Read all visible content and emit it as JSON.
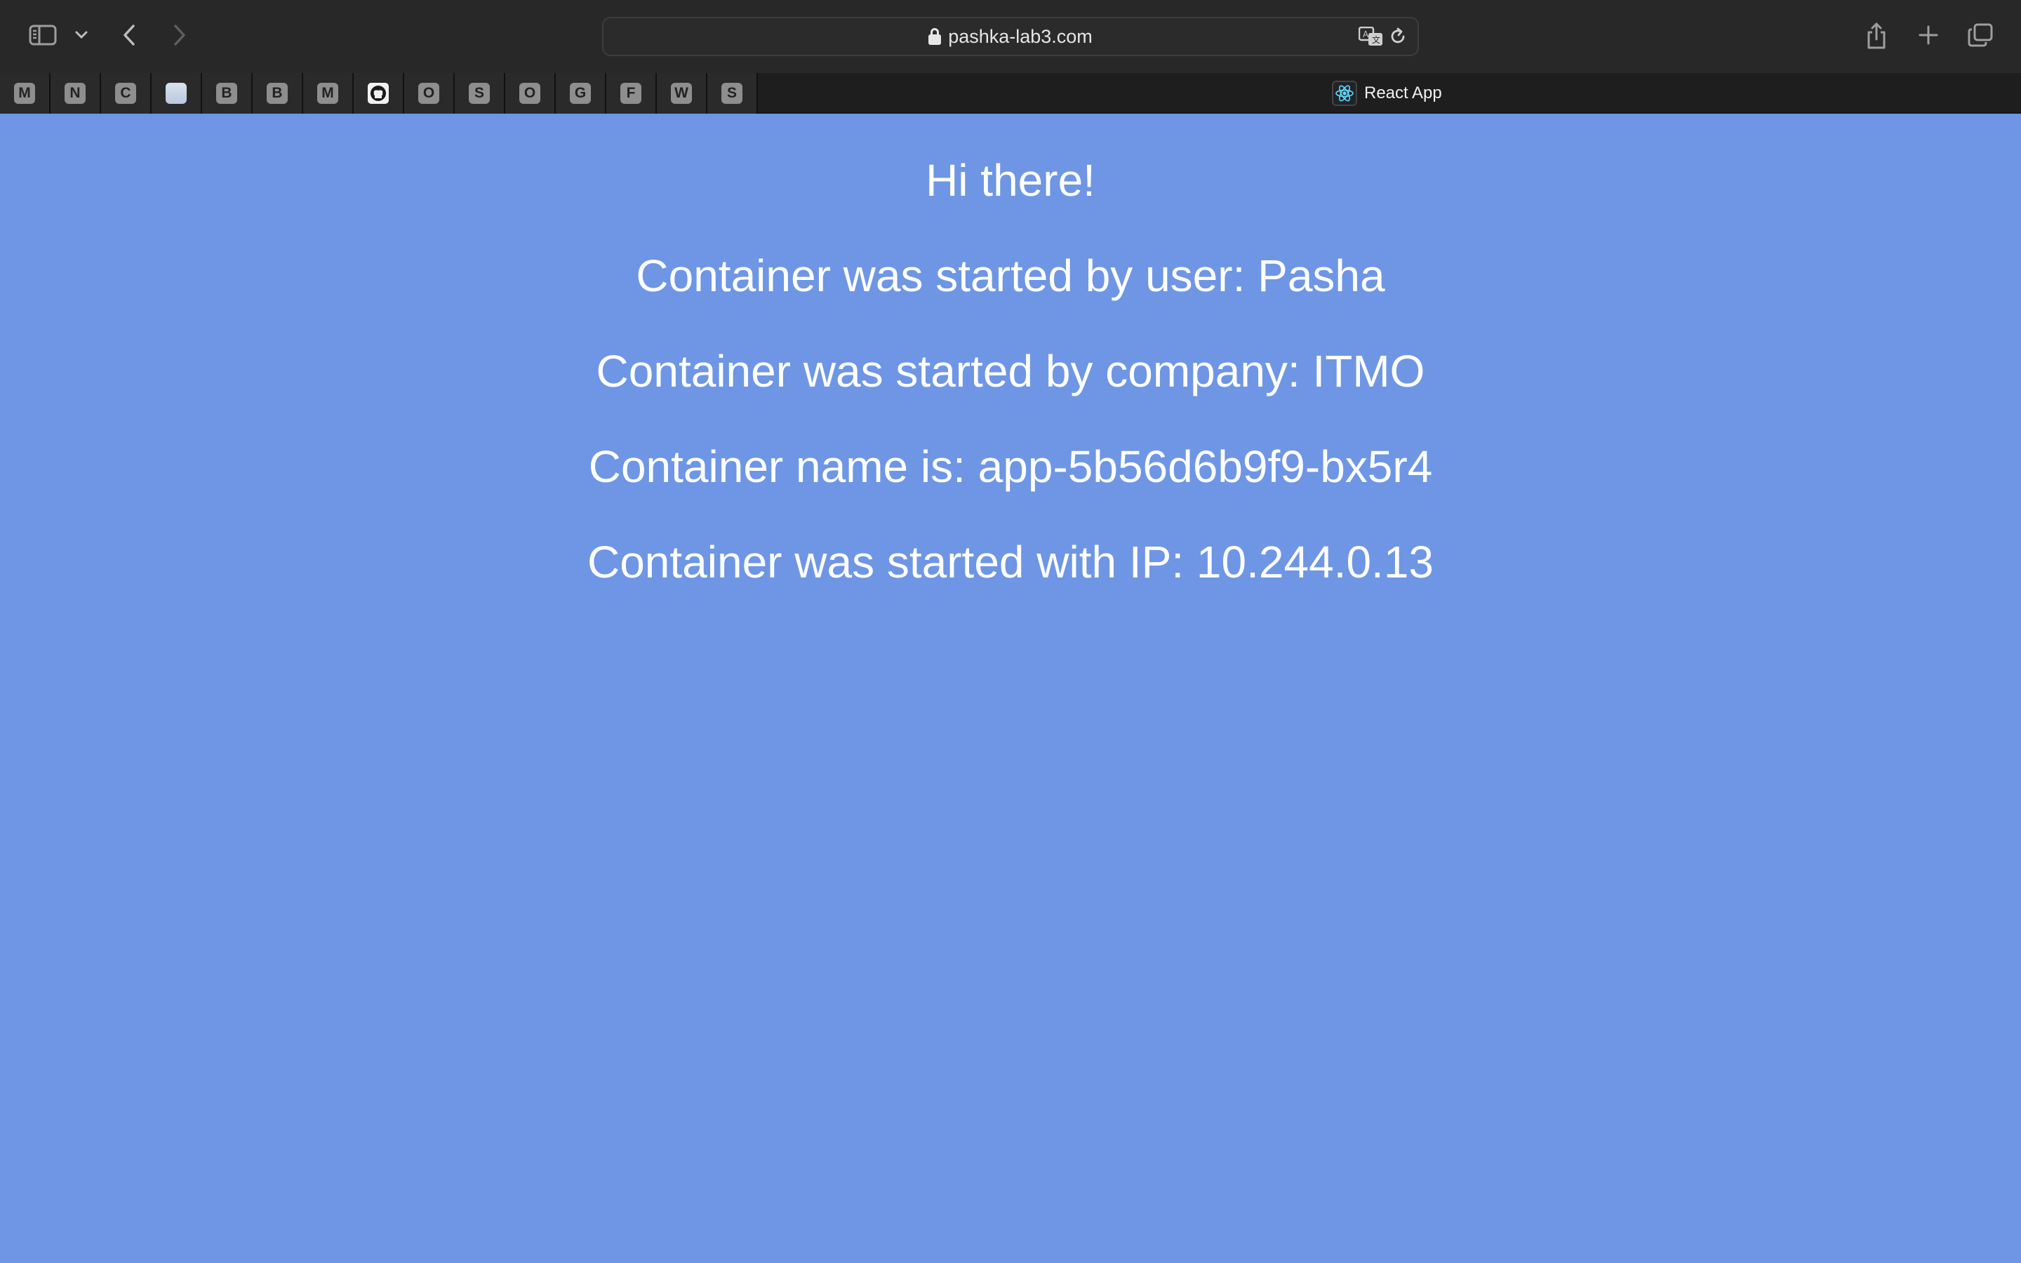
{
  "browser": {
    "url": "pashka-lab3.com",
    "pinned_tabs": [
      "M",
      "N",
      "C",
      "",
      "B",
      "B",
      "M",
      "",
      "O",
      "S",
      "O",
      "G",
      "F",
      "W",
      "S"
    ],
    "active_tab": {
      "title": "React App",
      "icon": "react-icon"
    }
  },
  "page": {
    "greeting": "Hi there!",
    "user_line": "Container was started by user: Pasha",
    "company_line": "Container was started by company: ITMO",
    "name_line": "Container name is: app-5b56d6b9f9-bx5r4",
    "ip_line": "Container was started with IP: 10.244.0.13"
  },
  "colors": {
    "background": "#6e96e5",
    "text": "#ffffff",
    "toolbar": "#282828"
  }
}
